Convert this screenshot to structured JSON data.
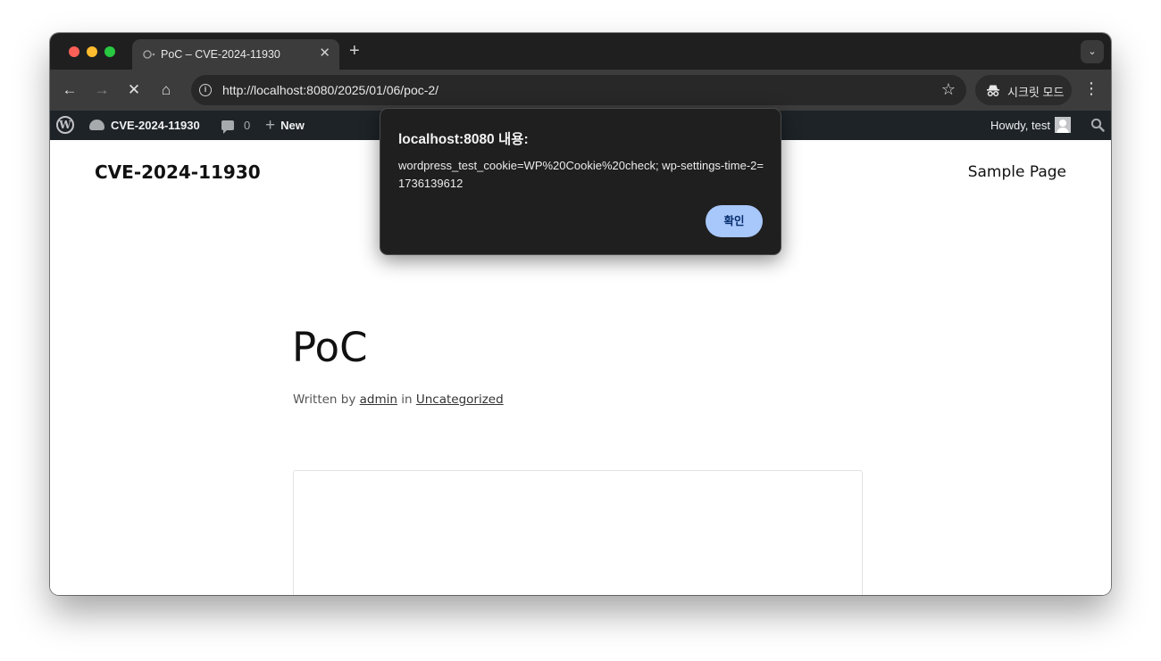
{
  "browser": {
    "tab": {
      "title": "PoC – CVE-2024-11930",
      "close": "✕"
    },
    "new_tab": "+",
    "tab_search": "⌄",
    "url": "http://localhost:8080/2025/01/06/poc-2/",
    "url_display": {
      "host": "localhost",
      "rest": ":8080/2025/01/06/poc-2/"
    },
    "incognito_label": "시크릿 모드",
    "menu": "⋮",
    "info": "i",
    "nav": {
      "back": "←",
      "forward": "→",
      "stop": "✕",
      "home": "⌂",
      "star": "☆"
    }
  },
  "admin_bar": {
    "wp_logo": "W",
    "site_name": "CVE-2024-11930",
    "comments_count": "0",
    "new_label": "New",
    "plus": "+",
    "howdy": "Howdy, test"
  },
  "site": {
    "title": "CVE-2024-11930",
    "nav_item": "Sample Page"
  },
  "post": {
    "title": "PoC",
    "meta_prefix": "Written by",
    "author": "admin",
    "meta_in": "in",
    "category": "Uncategorized"
  },
  "alert": {
    "title": "localhost:8080 내용:",
    "message": "wordpress_test_cookie=WP%20Cookie%20check; wp-settings-time-2=1736139612",
    "ok_label": "확인"
  }
}
